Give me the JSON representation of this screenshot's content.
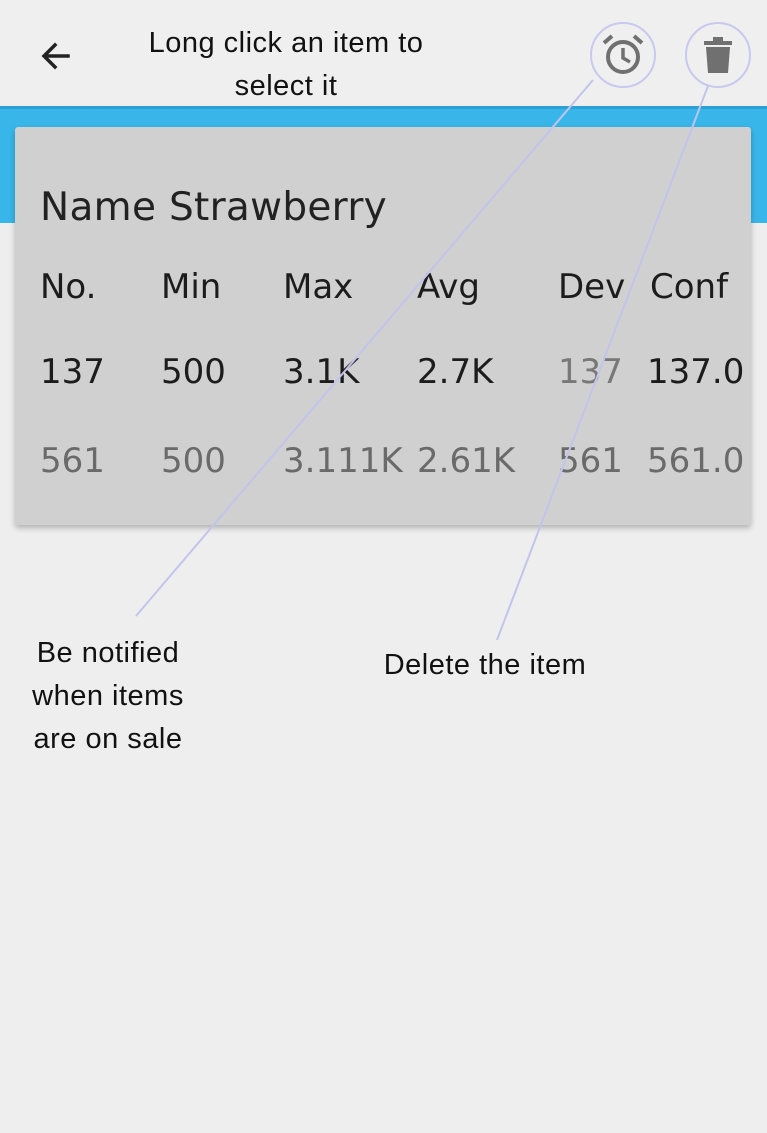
{
  "toolbar": {
    "hint": "Long click an item to select it",
    "back_icon": "arrow-left-icon",
    "alarm_icon": "alarm-clock-icon",
    "delete_icon": "trash-icon"
  },
  "card": {
    "title": "Name Strawberry",
    "headers": [
      "No.",
      "Min",
      "Max",
      "Avg",
      "Dev",
      "Conf"
    ],
    "rows": [
      [
        "137",
        "500",
        "3.1K",
        "2.7K",
        "137",
        "137.0"
      ],
      [
        "561",
        "500",
        "3.111K",
        "2.61K",
        "561",
        "561.0"
      ]
    ]
  },
  "annotations": {
    "notify": "Be notified when items are on sale",
    "delete": "Delete the item"
  },
  "colors": {
    "accent": "#38b6ea",
    "card": "#d0d0d0",
    "background": "#eeeeee",
    "annotation_line": "#c7c9ee"
  }
}
